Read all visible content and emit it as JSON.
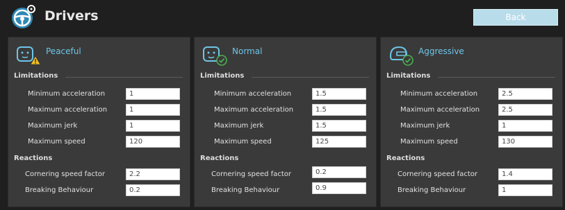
{
  "header": {
    "title": "Drivers",
    "back_label": "Back"
  },
  "sections": {
    "limitations": "Limitations",
    "reactions": "Reactions"
  },
  "labels": {
    "min_accel": "Minimum acceleration",
    "max_accel": "Maximum acceleration",
    "max_jerk": "Maximum jerk",
    "max_speed": "Maximum speed",
    "cornering": "Cornering speed factor",
    "braking": "Breaking Behaviour"
  },
  "profiles": [
    {
      "name": "Peaceful",
      "status_icon": "warning-icon",
      "min_accel": "1",
      "max_accel": "1",
      "max_jerk": "1",
      "max_speed": "120",
      "cornering": "2.2",
      "braking": "0.2"
    },
    {
      "name": "Normal",
      "status_icon": "check-icon",
      "min_accel": "1.5",
      "max_accel": "1.5",
      "max_jerk": "1.5",
      "max_speed": "125",
      "cornering": "0.2",
      "braking": "0.9"
    },
    {
      "name": "Aggressive",
      "status_icon": "check-icon",
      "min_accel": "2.5",
      "max_accel": "2.5",
      "max_jerk": "1",
      "max_speed": "130",
      "cornering": "1.4",
      "braking": "1"
    }
  ],
  "colors": {
    "accent": "#6ec6e8",
    "button": "#b9dcea",
    "check": "#4caf50",
    "warning": "#f2c01e"
  }
}
